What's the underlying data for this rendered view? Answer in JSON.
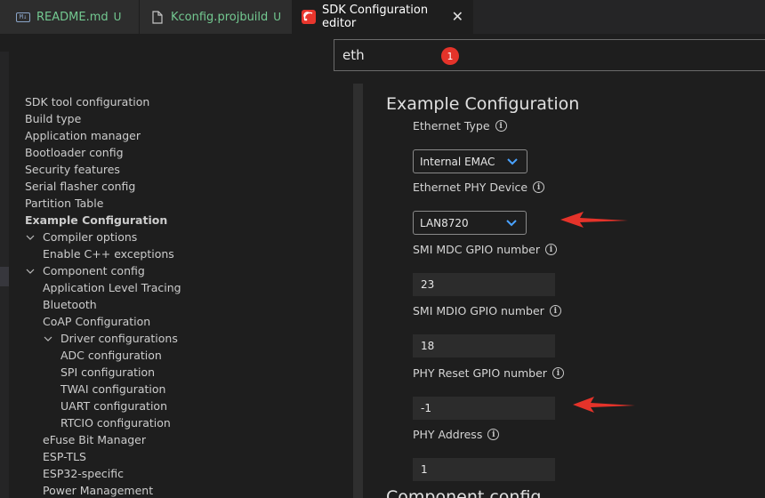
{
  "tabs": [
    {
      "label": "README.md",
      "status": "U",
      "icon": "markdown-icon",
      "state": "modified"
    },
    {
      "label": "Kconfig.projbuild",
      "status": "U",
      "icon": "file-icon"
    },
    {
      "label": "SDK Configuration editor",
      "icon": "esp-idf-icon",
      "active": true
    }
  ],
  "search": {
    "value": "eth",
    "badge": "1"
  },
  "tree": [
    {
      "label": "SDK tool configuration",
      "level": 0
    },
    {
      "label": "Build type",
      "level": 0
    },
    {
      "label": "Application manager",
      "level": 0
    },
    {
      "label": "Bootloader config",
      "level": 0
    },
    {
      "label": "Security features",
      "level": 0
    },
    {
      "label": "Serial flasher config",
      "level": 0
    },
    {
      "label": "Partition Table",
      "level": 0
    },
    {
      "label": "Example Configuration",
      "level": 0,
      "bold": true
    },
    {
      "label": "Compiler options",
      "level": 1,
      "expanded": true
    },
    {
      "label": "Enable C++ exceptions",
      "level": 1
    },
    {
      "label": "Component config",
      "level": 1,
      "expanded": true
    },
    {
      "label": "Application Level Tracing",
      "level": 1
    },
    {
      "label": "Bluetooth",
      "level": 1
    },
    {
      "label": "CoAP Configuration",
      "level": 1
    },
    {
      "label": "Driver configurations",
      "level": 2,
      "expanded": true
    },
    {
      "label": "ADC configuration",
      "level": 2
    },
    {
      "label": "SPI configuration",
      "level": 2
    },
    {
      "label": "TWAI configuration",
      "level": 2
    },
    {
      "label": "UART configuration",
      "level": 2
    },
    {
      "label": "RTCIO configuration",
      "level": 2
    },
    {
      "label": "eFuse Bit Manager",
      "level": 1
    },
    {
      "label": "ESP-TLS",
      "level": 1
    },
    {
      "label": "ESP32-specific",
      "level": 1
    },
    {
      "label": "Power Management",
      "level": 1
    }
  ],
  "panel": {
    "title": "Example Configuration",
    "next_title": "Component config",
    "ethernet_type": {
      "label": "Ethernet Type",
      "value": "Internal EMAC"
    },
    "phy_device": {
      "label": "Ethernet PHY Device",
      "value": "LAN8720"
    },
    "smi_mdc": {
      "label": "SMI MDC GPIO number",
      "value": "23"
    },
    "smi_mdio": {
      "label": "SMI MDIO GPIO number",
      "value": "18"
    },
    "phy_reset": {
      "label": "PHY Reset GPIO number",
      "value": "-1"
    },
    "phy_address": {
      "label": "PHY Address",
      "value": "1"
    }
  },
  "colors": {
    "accent_red": "#e5332a",
    "tab_green": "#73c991",
    "caret_blue": "#4aa3ff"
  }
}
